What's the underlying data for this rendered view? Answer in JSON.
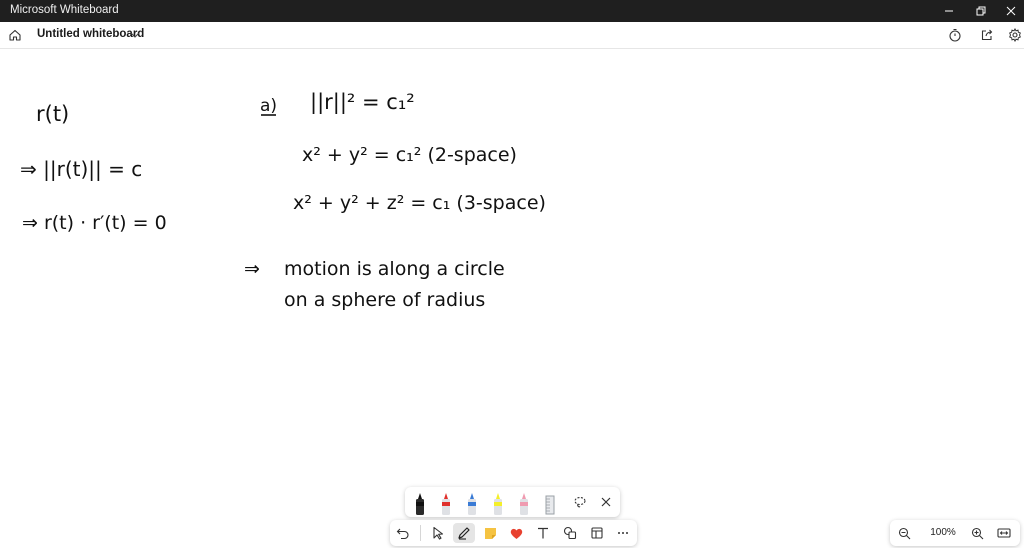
{
  "window": {
    "title": "Microsoft Whiteboard",
    "controls": [
      "minimize-icon",
      "restore-icon",
      "close-icon"
    ]
  },
  "header": {
    "board_title": "Untitled whiteboard",
    "icons": [
      "home-icon",
      "chevron-down-icon",
      "timer-icon",
      "share-icon",
      "settings-icon"
    ]
  },
  "ink": {
    "left": {
      "line1": "r(t)",
      "line2": "⇒  ||r(t)|| = c",
      "line3": "⇒  r(t) · r′(t) = 0"
    },
    "right": {
      "label": "a)",
      "line1": "||r||² = c₁²",
      "line2": "x² + y² = c₁²  (2-space)",
      "line3": "x² + y² + z² = c₁  (3-space)",
      "arrow": "⇒",
      "line4": "motion is along a circle",
      "line5": "on a sphere of radius"
    }
  },
  "pen_tray": {
    "pens": [
      {
        "name": "black-pen",
        "color": "#111111"
      },
      {
        "name": "red-pen",
        "color": "#e0302c"
      },
      {
        "name": "blue-pen",
        "color": "#3a7bd5"
      },
      {
        "name": "yellow-highlighter",
        "color": "#f4ef2a"
      },
      {
        "name": "pink-pen",
        "color": "#ef9bb0"
      },
      {
        "name": "ruler",
        "color": "#9aa0a6"
      }
    ],
    "tools": [
      "lasso-icon",
      "close-icon"
    ]
  },
  "toolbar": {
    "tools": [
      "undo-icon",
      "select-icon",
      "pen-icon",
      "sticky-note-icon",
      "reaction-icon",
      "text-icon",
      "shapes-icon",
      "templates-icon",
      "more-icon"
    ],
    "active": "pen-icon"
  },
  "zoom": {
    "level": "100%",
    "icons": [
      "zoom-out-icon",
      "zoom-in-icon",
      "fit-to-screen-icon"
    ]
  }
}
